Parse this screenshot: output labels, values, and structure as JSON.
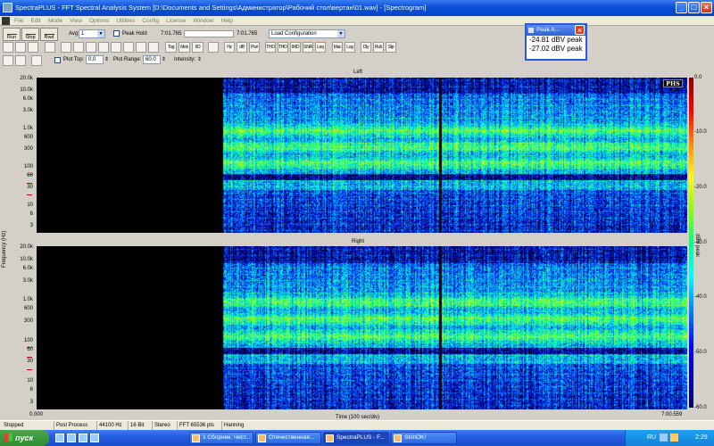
{
  "window": {
    "title": "SpectraPLUS - FFT Spectral Analysis System [D:\\Documents and Settings\\Администратор\\Рабочий стол\\вертан\\01.wav] - [Spectrogram]",
    "controls": [
      "_",
      "□",
      "×"
    ]
  },
  "menu": [
    "File",
    "Edit",
    "Mode",
    "View",
    "Options",
    "Utilities",
    "Config",
    "License",
    "Window",
    "Help"
  ],
  "toolbar": {
    "run_label": "Run",
    "stop_label": "Stop",
    "rew_label": "Rwd",
    "avg_label": "Avg:",
    "avg_value": "1",
    "peak_hold_label": "Peak Hold",
    "time_start": "7:01.765",
    "time_end": "7:01.765",
    "config_value": "Load Configuration",
    "row2_tools": [
      "Tog",
      "Mek",
      "I/O",
      "Hz",
      "dB",
      "Pwr",
      "THD",
      "THD+N",
      "IMD",
      "SNR",
      "Leq",
      "Mac",
      "Log",
      "Dly",
      "Rvb",
      "Stp"
    ],
    "plot_top_label": "Plot Top:",
    "plot_top_value": "0.0",
    "plot_range_label": "Plot Range:",
    "plot_range_value": "60.0",
    "intensity_label": "Intensity:"
  },
  "peak_window": {
    "title": "Peak A...",
    "values": [
      "-24.81 dBV peak",
      "-27.02 dBV peak"
    ]
  },
  "plot": {
    "left_title": "Left",
    "right_title": "Right",
    "ylabel": "Frequency (Hz)",
    "xlabel": "Time (100 sec/div)",
    "x_start": "0.000",
    "x_end": "7:00.559",
    "yticks": [
      "20.0k",
      "10.0k",
      "6.0k",
      "3.0k",
      "1.0k",
      "600",
      "300",
      "100",
      "60",
      "30",
      "10",
      "6",
      "3"
    ],
    "colorbar_label": "dBV peak",
    "colorbar_ticks": [
      "0.0",
      "-10.0",
      "-20.0",
      "-30.0",
      "-40.0",
      "-50.0",
      "-60.0"
    ],
    "logo": "PHS"
  },
  "status": {
    "fields": [
      "Stopped",
      "Post Process",
      "44100 Hz",
      "16 Bit",
      "Stereo",
      "FFT 65536 pts",
      "Hanning"
    ]
  },
  "taskbar": {
    "start_label": "пуск",
    "tasks": [
      "1 Сборник. Чист...",
      "Отечественная...",
      "SpectraPLUS - F...",
      "StimOK!"
    ],
    "lang": "RU",
    "clock": "2:29"
  }
}
